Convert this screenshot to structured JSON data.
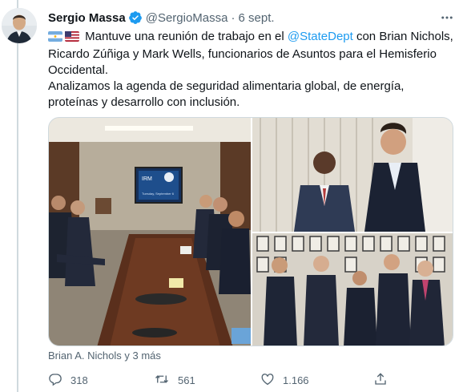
{
  "tweet": {
    "author": {
      "name": "Sergio Massa",
      "handle": "@SergioMassa"
    },
    "separator": "·",
    "date": "6 sept.",
    "text": {
      "line1_prefix": "Mantuve una reunión de trabajo en el ",
      "mention": "@StateDept",
      "line1_suffix": " con Brian Nichols, Ricardo Zúñiga y Mark Wells, funcionarios de Asuntos para el Hemisferio Occidental.",
      "paragraph2": "Analizamos la agenda de seguridad alimentaria global, de energía, proteínas y desarrollo con inclusión."
    },
    "flags": [
      "argentina-flag-icon",
      "usa-flag-icon"
    ],
    "screen_text": {
      "line1": "IRM",
      "line2": "Tuesday, September 6"
    },
    "tagged_people": "Brian A. Nichols y 3 más",
    "actions": {
      "replies": "318",
      "retweets": "561",
      "likes": "1.166"
    }
  },
  "colors": {
    "text": "#0f1419",
    "secondary": "#536471",
    "accent": "#1d9bf0",
    "border": "#cfd9de"
  },
  "icons": [
    "verified-badge-icon",
    "more-icon",
    "reply-icon",
    "retweet-icon",
    "like-icon",
    "share-icon"
  ]
}
